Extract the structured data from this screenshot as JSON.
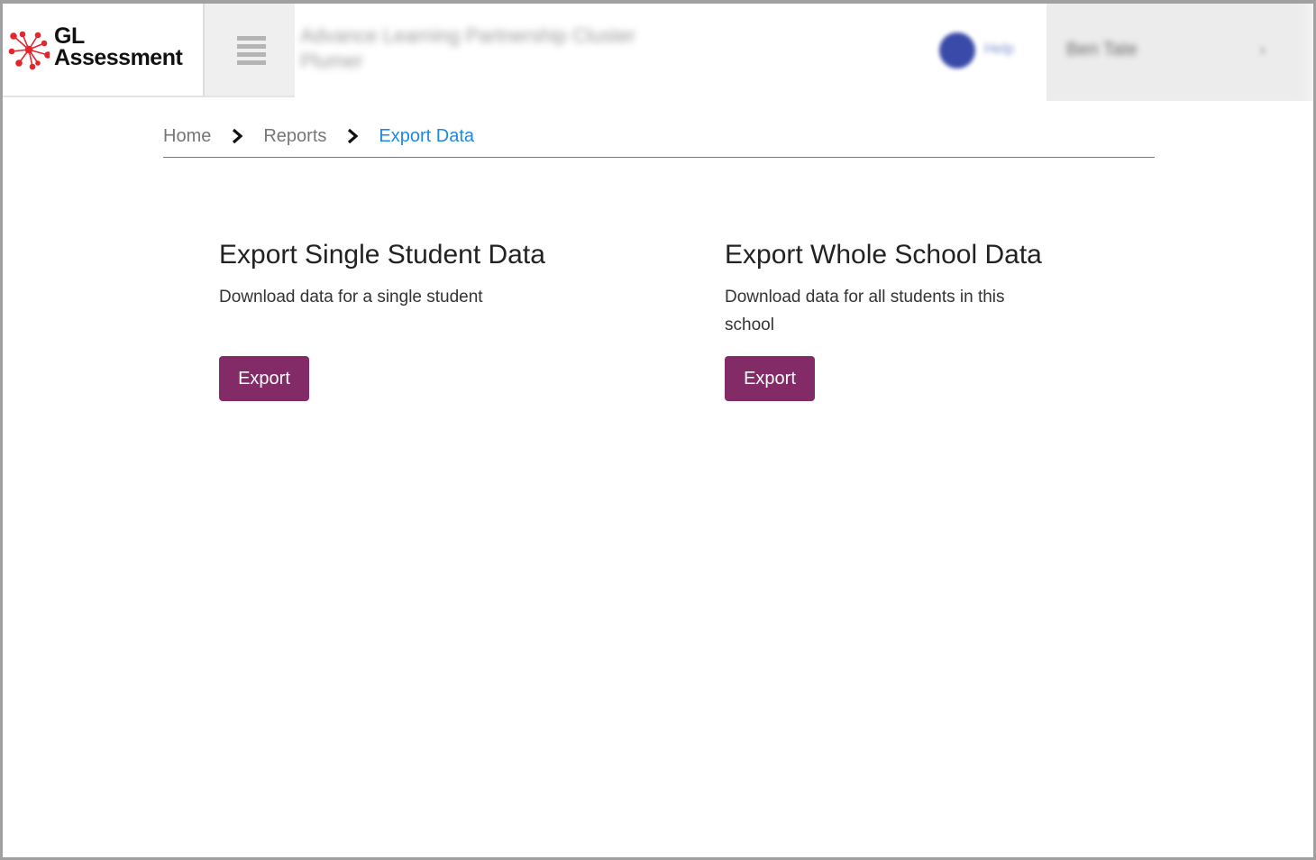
{
  "header": {
    "logo": {
      "line1": "GL",
      "line2": "Assessment",
      "icon": "gl-starburst-logo-icon",
      "icon_color": "#e3262e"
    },
    "menu_icon": "hamburger-menu-icon",
    "org_title_line1": "Advance Learning Partnership Cluster",
    "org_title_line2": "Plumer",
    "user": {
      "avatar_color": "#3a4aa8",
      "label": "Help"
    },
    "account": {
      "name": "Ben Tate",
      "chevron": "›"
    }
  },
  "breadcrumb": {
    "items": [
      {
        "label": "Home"
      },
      {
        "label": "Reports"
      },
      {
        "label": "Export Data",
        "active": true
      }
    ],
    "separator_icon": "chevron-right-icon",
    "active_color": "#1e88e5"
  },
  "cards": [
    {
      "title": "Export Single Student Data",
      "description": "Download data for a single student",
      "button_label": "Export"
    },
    {
      "title": "Export Whole School Data",
      "description": "Download data for all students in this school",
      "button_label": "Export"
    }
  ],
  "colors": {
    "button": "#832b67",
    "link_active": "#1e88e5"
  }
}
